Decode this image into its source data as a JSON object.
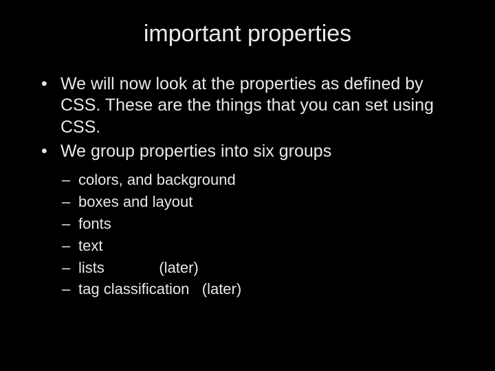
{
  "title": "important properties",
  "bullets": [
    "We will now look at the properties as defined by CSS. These are the things that you can set using CSS.",
    "We group properties into six groups"
  ],
  "subitems": [
    "colors, and background",
    "boxes and layout",
    "fonts",
    "text",
    "lists             (later)",
    "tag classification   (later)"
  ]
}
